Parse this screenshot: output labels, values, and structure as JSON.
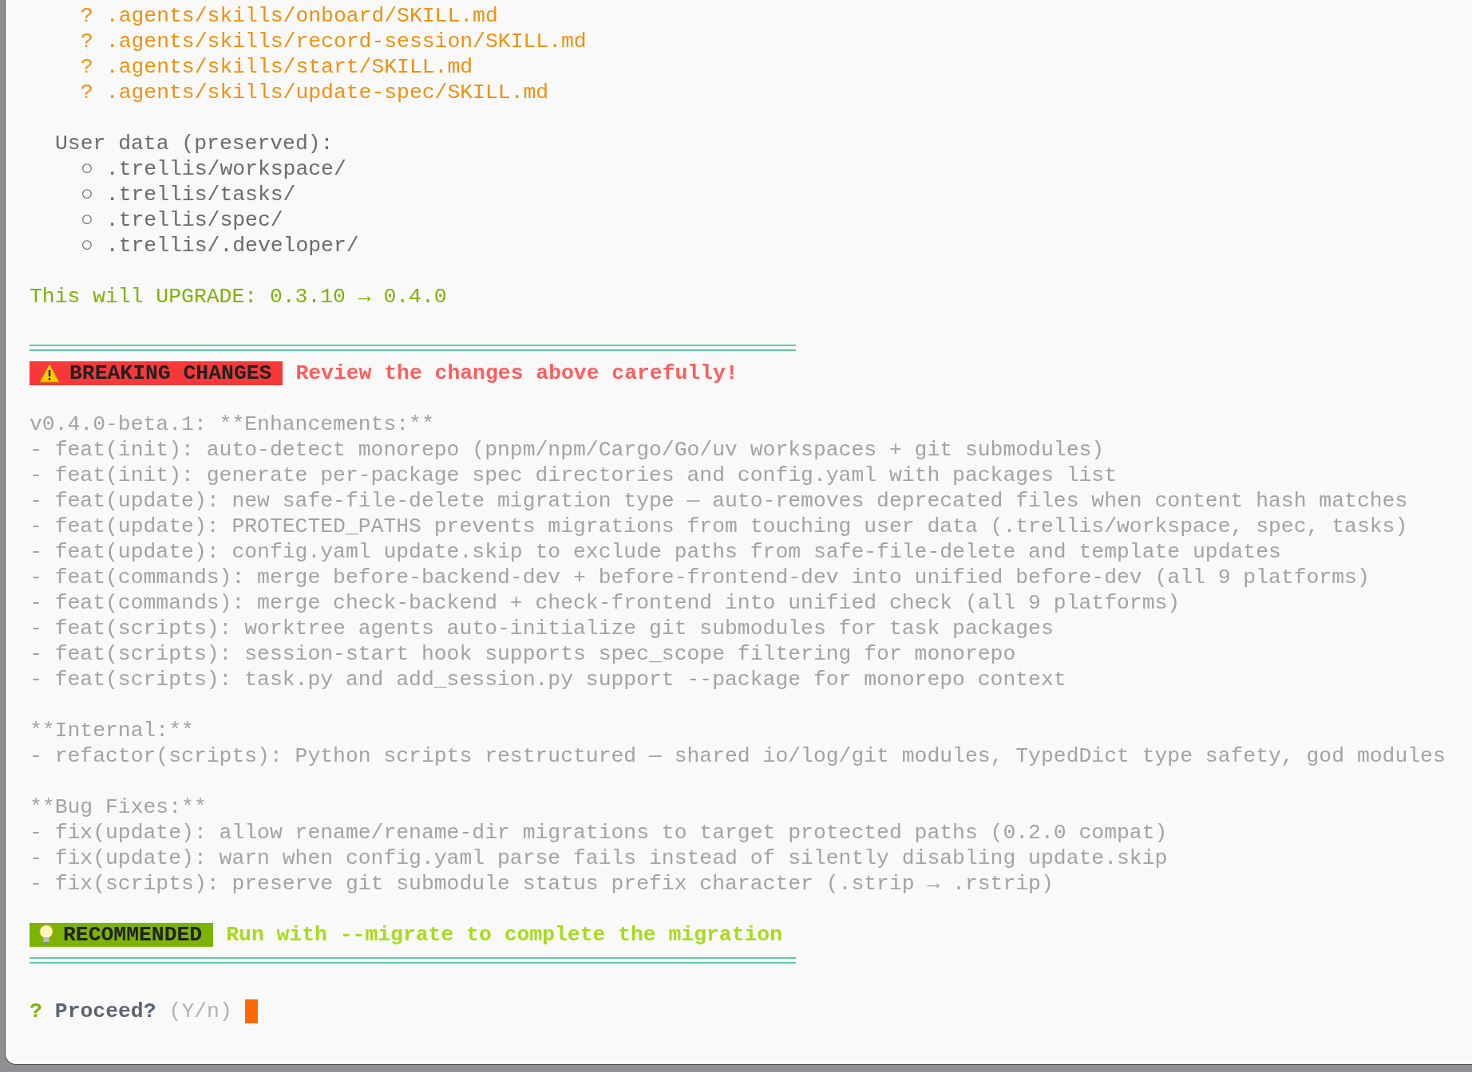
{
  "untracked_files": [
    {
      "marker": "?",
      "path": ".agents/skills/onboard/SKILL.md"
    },
    {
      "marker": "?",
      "path": ".agents/skills/record-session/SKILL.md"
    },
    {
      "marker": "?",
      "path": ".agents/skills/start/SKILL.md"
    },
    {
      "marker": "?",
      "path": ".agents/skills/update-spec/SKILL.md"
    }
  ],
  "user_data": {
    "heading": "User data (preserved):",
    "items": [
      {
        "bullet": "○",
        "path": ".trellis/workspace/"
      },
      {
        "bullet": "○",
        "path": ".trellis/tasks/"
      },
      {
        "bullet": "○",
        "path": ".trellis/spec/"
      },
      {
        "bullet": "○",
        "path": ".trellis/.developer/"
      }
    ]
  },
  "upgrade_notice": "This will UPGRADE: 0.3.10 → 0.4.0",
  "breaking": {
    "badge": "BREAKING CHANGES",
    "message": "Review the changes above carefully!"
  },
  "changelog": [
    {
      "heading": "v0.4.0-beta.1: **Enhancements:**",
      "items": [
        "- feat(init): auto-detect monorepo (pnpm/npm/Cargo/Go/uv workspaces + git submodules)",
        "- feat(init): generate per-package spec directories and config.yaml with packages list",
        "- feat(update): new safe-file-delete migration type — auto-removes deprecated files when content hash matches",
        "- feat(update): PROTECTED_PATHS prevents migrations from touching user data (.trellis/workspace, spec, tasks)",
        "- feat(update): config.yaml update.skip to exclude paths from safe-file-delete and template updates",
        "- feat(commands): merge before-backend-dev + before-frontend-dev into unified before-dev (all 9 platforms)",
        "- feat(commands): merge check-backend + check-frontend into unified check (all 9 platforms)",
        "- feat(scripts): worktree agents auto-initialize git submodules for task packages",
        "- feat(scripts): session-start hook supports spec_scope filtering for monorepo",
        "- feat(scripts): task.py and add_session.py support --package for monorepo context"
      ]
    },
    {
      "heading": "**Internal:**",
      "items": [
        "- refactor(scripts): Python scripts restructured — shared io/log/git modules, TypedDict type safety, god modules"
      ]
    },
    {
      "heading": "**Bug Fixes:**",
      "items": [
        "- fix(update): allow rename/rename-dir migrations to target protected paths (0.2.0 compat)",
        "- fix(update): warn when config.yaml parse fails instead of silently disabling update.skip",
        "- fix(scripts): preserve git submodule status prefix character (.strip → .rstrip)"
      ]
    }
  ],
  "recommended": {
    "badge": "RECOMMENDED",
    "message": "Run with --migrate to complete the migration"
  },
  "prompt": {
    "marker": "?",
    "question": "Proceed?",
    "hint": "(Y/n)"
  }
}
